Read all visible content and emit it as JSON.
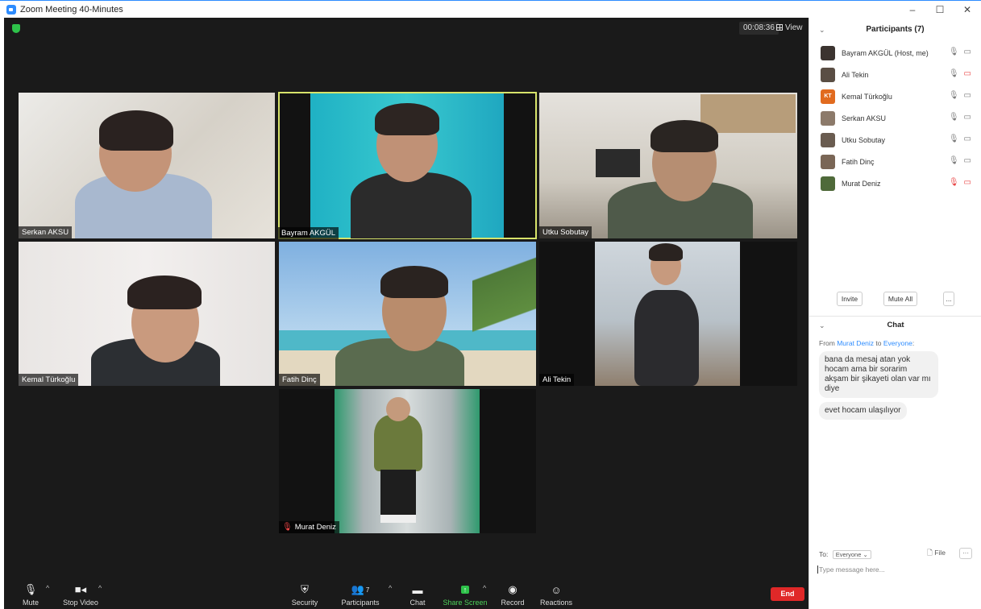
{
  "window": {
    "title": "Zoom Meeting 40-Minutes",
    "controls": [
      "–",
      "☐",
      "✕"
    ]
  },
  "meeting": {
    "timer": "00:08:36",
    "view_label": "View",
    "tiles": [
      {
        "name": "Serkan AKSU",
        "muted": false
      },
      {
        "name": "Bayram AKGÜL",
        "muted": false,
        "active": true
      },
      {
        "name": "Utku Sobutay",
        "muted": false
      },
      {
        "name": "Kemal Türkoğlu",
        "muted": false
      },
      {
        "name": "Fatih Dinç",
        "muted": false
      },
      {
        "name": "Ali Tekin",
        "muted": false
      },
      {
        "name": "Murat Deniz",
        "muted": true
      }
    ]
  },
  "toolbar": {
    "mute": "Mute",
    "stop_video": "Stop Video",
    "security": "Security",
    "participants": "Participants",
    "participants_count": "7",
    "chat": "Chat",
    "share_screen": "Share Screen",
    "record": "Record",
    "reactions": "Reactions",
    "end": "End"
  },
  "participants_panel": {
    "title": "Participants (7)",
    "list": [
      {
        "name": "Bayram AKGÜL (Host, me)",
        "avatar": "",
        "mic_muted": false,
        "video_off": false
      },
      {
        "name": "Ali Tekin",
        "avatar": "",
        "mic_muted": false,
        "video_off": true
      },
      {
        "name": "Kemal Türkoğlu",
        "avatar": "KT",
        "mic_muted": false,
        "video_off": false
      },
      {
        "name": "Serkan AKSU",
        "avatar": "",
        "mic_muted": false,
        "video_off": false
      },
      {
        "name": "Utku Sobutay",
        "avatar": "",
        "mic_muted": false,
        "video_off": false
      },
      {
        "name": "Fatih Dinç",
        "avatar": "",
        "mic_muted": false,
        "video_off": false
      },
      {
        "name": "Murat Deniz",
        "avatar": "",
        "mic_muted": true,
        "video_off": true
      }
    ],
    "invite": "Invite",
    "mute_all": "Mute All",
    "more": "..."
  },
  "chat_panel": {
    "title": "Chat",
    "from_prefix": "From",
    "from_name": "Murat Deniz",
    "to_word": "to",
    "to_name": "Everyone",
    "messages": [
      "bana da mesaj atan yok hocam ama bir sorarim akşam bir şikayeti olan var mı diye",
      "evet hocam ulaşılıyor"
    ],
    "to_label": "To:",
    "to_select": "Everyone",
    "file_label": "File",
    "more": "···",
    "input_placeholder": "Type message here..."
  }
}
